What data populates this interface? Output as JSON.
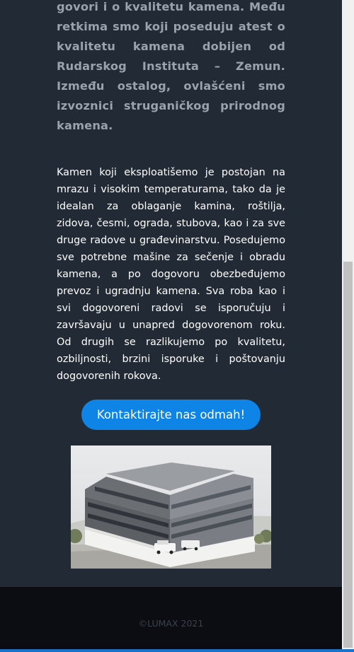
{
  "intro": {
    "text": "govori i o kvalitetu kamena. Među retkima smo koji poseduju atest o kvalitetu kamena dobijen od Rudarskog Instituta – Zemun. Između ostalog, ovlašćeni smo izvoznici struganičkog prirodnog kamena."
  },
  "body": {
    "text": "Kamen koji eksploatišemo je postojan na mrazu i visokim temperaturama, tako da je idealan za oblaganje kamina, roštilja, zidova, česmi, ograda, stubova, kao i za sve druge radove u građevinarstvu. Posedujemo sve potrebne mašine za sečenje i obradu kamena, a po dogovoru obezbeđujemo prevoz i ugradnju kamena. Sva roba kao i svi dogovoreni radovi se isporučuju i završavaju u unapred dogovorenom roku. Od drugih se razlikujemo po kvalitetu, ozbiljnosti, brzini isporuke i poštovanju dogovorenih rokova."
  },
  "cta": {
    "label": "Kontaktirajte nas odmah!"
  },
  "footer": {
    "copyright": "©LUMAX 2021"
  },
  "colors": {
    "background": "#222a35",
    "accent": "#0d84e6",
    "footer": "#0b0d12"
  }
}
